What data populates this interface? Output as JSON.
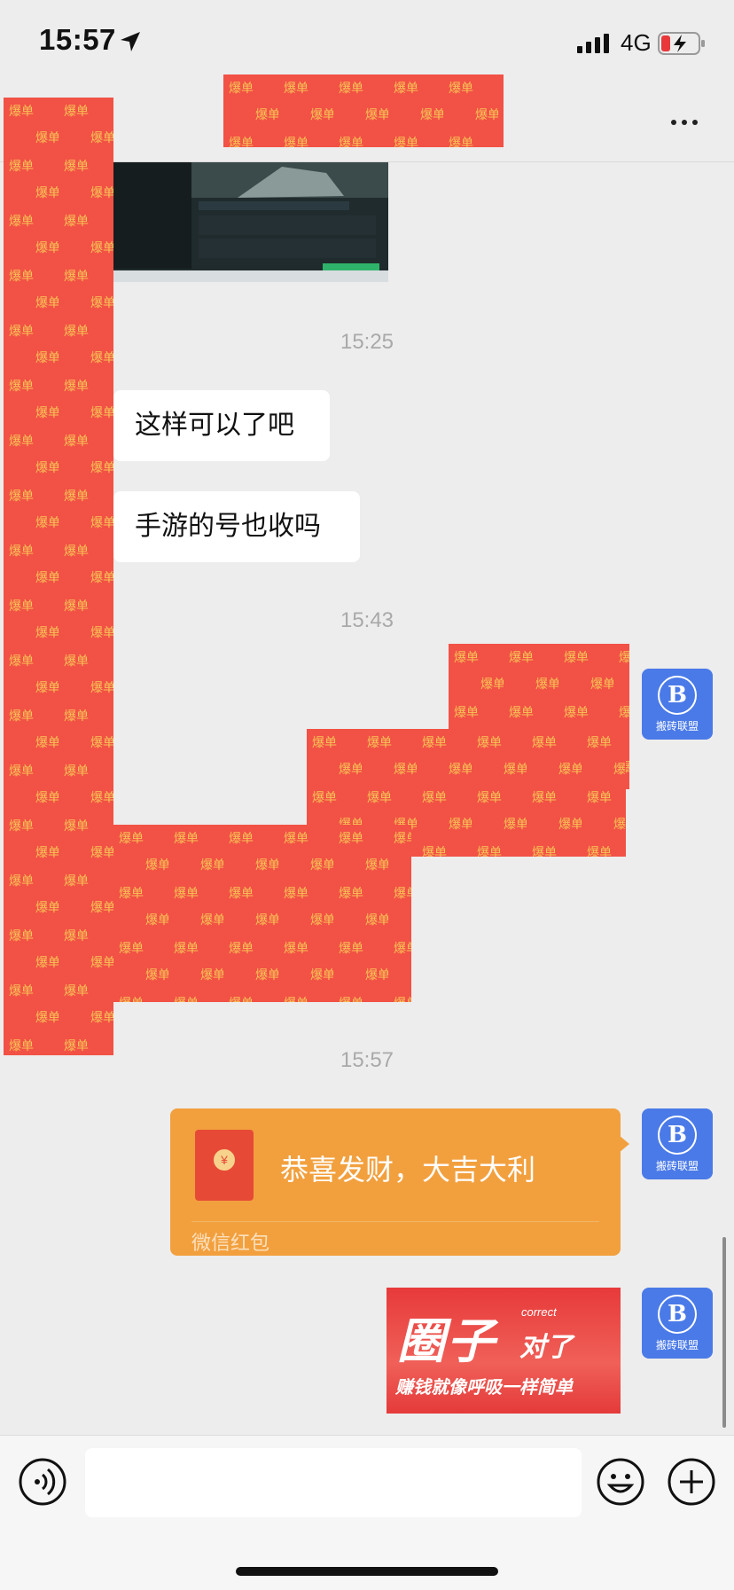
{
  "status_bar": {
    "time": "15:57",
    "network": "4G"
  },
  "chat": {
    "timestamps": [
      "15:25",
      "15:43",
      "15:57"
    ],
    "incoming_messages": [
      "这样可以了吧",
      "手游的号也收吗"
    ],
    "avatar_name": "搬砖联盟",
    "avatar_logo": "B",
    "censor_text": "爆单"
  },
  "red_packet": {
    "greeting": "恭喜发财，大吉大利",
    "label": "微信红包",
    "coin_symbol": "¥"
  },
  "ad": {
    "big_text": "圈子",
    "correct_text": "correct",
    "dui_text": "对了",
    "slogan": "赚钱就像呼吸一样简单"
  },
  "colors": {
    "censor_red": "#f25145",
    "censor_text_yellow": "#f7c455",
    "avatar_blue": "#4a7ae8",
    "red_packet_orange": "#f2a03e"
  }
}
